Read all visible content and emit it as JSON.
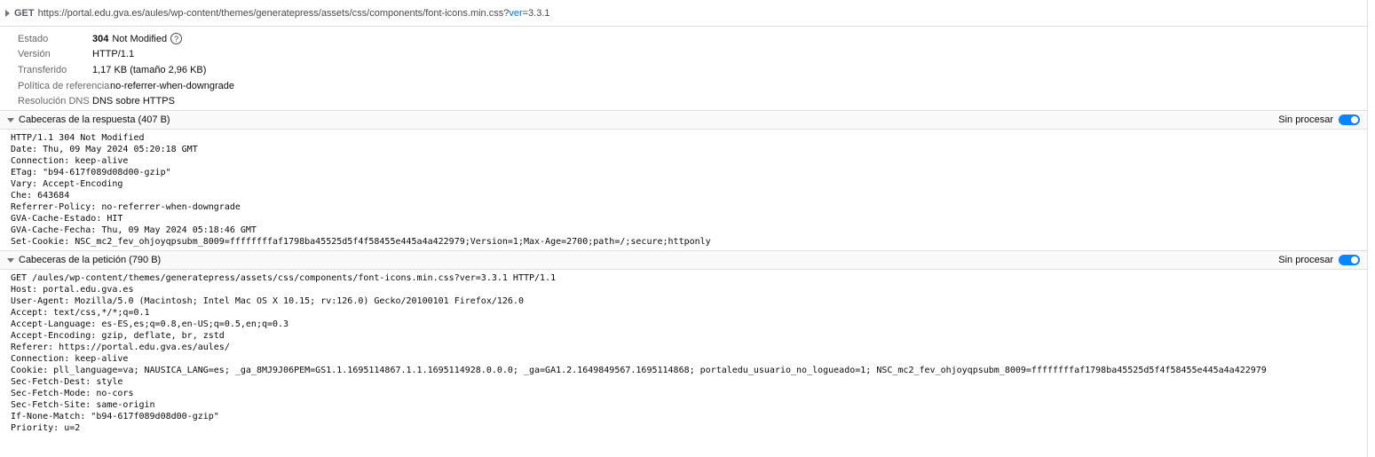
{
  "request_line": {
    "method": "GET",
    "url_base": "https://portal.edu.gva.es/aules/wp-content/themes/generatepress/assets/css/components/font-icons.min.css?",
    "param_key": "ver",
    "param_rest": "=3.3.1"
  },
  "summary": {
    "status_label": "Estado",
    "status_code": "304",
    "status_text": "Not Modified",
    "version_label": "Versión",
    "version": "HTTP/1.1",
    "transfer_label": "Transferido",
    "transfer": "1,17 KB (tamaño 2,96 KB)",
    "policy_label": "Política de referencia",
    "policy": "no-referrer-when-downgrade",
    "dns_label": "Resolución DNS",
    "dns": "DNS sobre HTTPS"
  },
  "response_headers": {
    "title": "Cabeceras de la respuesta (407 B)",
    "raw_label": "Sin procesar",
    "raw_enabled": true,
    "lines": [
      "HTTP/1.1 304 Not Modified",
      "Date: Thu, 09 May 2024 05:20:18 GMT",
      "Connection: keep-alive",
      "ETag: \"b94-617f089d08d00-gzip\"",
      "Vary: Accept-Encoding",
      "Che: 643684",
      "Referrer-Policy: no-referrer-when-downgrade",
      "GVA-Cache-Estado: HIT",
      "GVA-Cache-Fecha: Thu, 09 May 2024 05:18:46 GMT",
      "Set-Cookie: NSC_mc2_fev_ohjoyqpsubm_8009=ffffffffaf1798ba45525d5f4f58455e445a4a422979;Version=1;Max-Age=2700;path=/;secure;httponly"
    ]
  },
  "request_headers": {
    "title": "Cabeceras de la petición (790 B)",
    "raw_label": "Sin procesar",
    "raw_enabled": true,
    "lines": [
      "GET /aules/wp-content/themes/generatepress/assets/css/components/font-icons.min.css?ver=3.3.1 HTTP/1.1",
      "Host: portal.edu.gva.es",
      "User-Agent: Mozilla/5.0 (Macintosh; Intel Mac OS X 10.15; rv:126.0) Gecko/20100101 Firefox/126.0",
      "Accept: text/css,*/*;q=0.1",
      "Accept-Language: es-ES,es;q=0.8,en-US;q=0.5,en;q=0.3",
      "Accept-Encoding: gzip, deflate, br, zstd",
      "Referer: https://portal.edu.gva.es/aules/",
      "Connection: keep-alive",
      "Cookie: pll_language=va; NAUSICA_LANG=es; _ga_8MJ9J06PEM=GS1.1.1695114867.1.1.1695114928.0.0.0; _ga=GA1.2.1649849567.1695114868; portaledu_usuario_no_logueado=1; NSC_mc2_fev_ohjoyqpsubm_8009=ffffffffaf1798ba45525d5f4f58455e445a4a422979",
      "Sec-Fetch-Dest: style",
      "Sec-Fetch-Mode: no-cors",
      "Sec-Fetch-Site: same-origin",
      "If-None-Match: \"b94-617f089d08d00-gzip\"",
      "Priority: u=2"
    ]
  },
  "colors": {
    "accent": "#0a84ff",
    "param_key": "#0074e8",
    "label_gray": "#6a6a6f"
  }
}
